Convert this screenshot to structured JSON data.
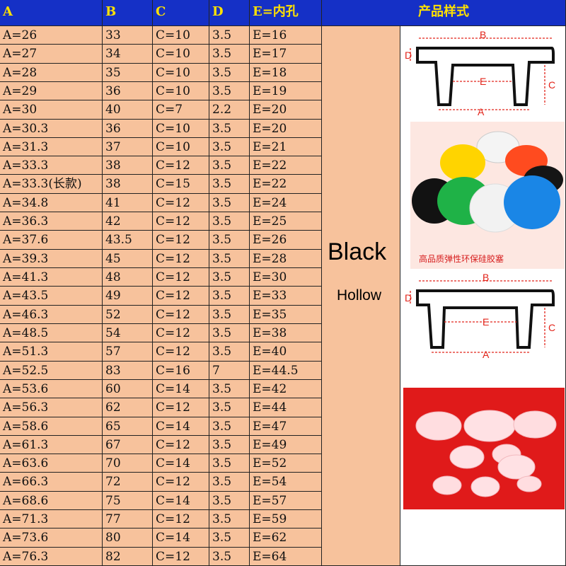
{
  "table": {
    "headers": [
      "A",
      "B",
      "C",
      "D",
      "E=内孔",
      "产品样式"
    ],
    "rows": [
      [
        "A=26",
        "33",
        "C=10",
        "3.5",
        "E=16"
      ],
      [
        "A=27",
        "34",
        "C=10",
        "3.5",
        "E=17"
      ],
      [
        "A=28",
        "35",
        "C=10",
        "3.5",
        "E=18"
      ],
      [
        "A=29",
        "36",
        "C=10",
        "3.5",
        "E=19"
      ],
      [
        "A=30",
        "40",
        "C=7",
        "2.2",
        "E=20"
      ],
      [
        "A=30.3",
        "36",
        "C=10",
        "3.5",
        "E=20"
      ],
      [
        "A=31.3",
        "37",
        "C=10",
        "3.5",
        "E=21"
      ],
      [
        "A=33.3",
        "38",
        "C=12",
        "3.5",
        "E=22"
      ],
      [
        "A=33.3(长款)",
        "38",
        "C=15",
        "3.5",
        "E=22"
      ],
      [
        "A=34.8",
        "41",
        "C=12",
        "3.5",
        "E=24"
      ],
      [
        "A=36.3",
        "42",
        "C=12",
        "3.5",
        "E=25"
      ],
      [
        "A=37.6",
        "43.5",
        "C=12",
        "3.5",
        "E=26"
      ],
      [
        "A=39.3",
        "45",
        "C=12",
        "3.5",
        "E=28"
      ],
      [
        "A=41.3",
        "48",
        "C=12",
        "3.5",
        "E=30"
      ],
      [
        "A=43.5",
        "49",
        "C=12",
        "3.5",
        "E=33"
      ],
      [
        "A=46.3",
        "52",
        "C=12",
        "3.5",
        "E=35"
      ],
      [
        "A=48.5",
        "54",
        "C=12",
        "3.5",
        "E=38"
      ],
      [
        "A=51.3",
        "57",
        "C=12",
        "3.5",
        "E=40"
      ],
      [
        "A=52.5",
        "83",
        "C=16",
        "7",
        "E=44.5"
      ],
      [
        "A=53.6",
        "60",
        "C=14",
        "3.5",
        "E=42"
      ],
      [
        "A=56.3",
        "62",
        "C=12",
        "3.5",
        "E=44"
      ],
      [
        "A=58.6",
        "65",
        "C=14",
        "3.5",
        "E=47"
      ],
      [
        "A=61.3",
        "67",
        "C=12",
        "3.5",
        "E=49"
      ],
      [
        "A=63.6",
        "70",
        "C=14",
        "3.5",
        "E=52"
      ],
      [
        "A=66.3",
        "72",
        "C=12",
        "3.5",
        "E=54"
      ],
      [
        "A=68.6",
        "75",
        "C=14",
        "3.5",
        "E=57"
      ],
      [
        "A=71.3",
        "77",
        "C=12",
        "3.5",
        "E=59"
      ],
      [
        "A=73.6",
        "80",
        "C=14",
        "3.5",
        "E=62"
      ],
      [
        "A=76.3",
        "82",
        "C=12",
        "3.5",
        "E=64"
      ]
    ]
  },
  "color_label": "Black",
  "style_label": "Hollow",
  "diagram": {
    "label_a": "A",
    "label_b": "B",
    "label_c": "C",
    "label_d": "D",
    "label_e": "E"
  },
  "photo_caption": "高品质弹性环保硅胶塞",
  "colors": {
    "header_bg": "#1530c6",
    "header_text": "#ffe100",
    "cell_bg": "#f7c29c",
    "dim_red": "#e2241a",
    "red_bg": "#e01a1a"
  }
}
